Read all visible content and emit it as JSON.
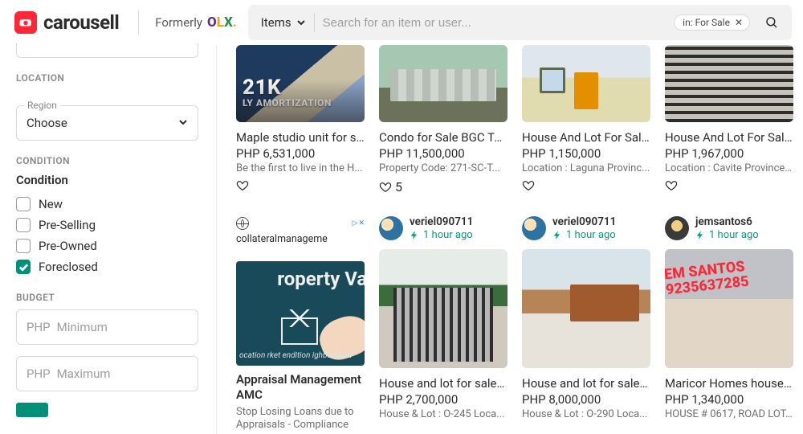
{
  "header": {
    "brand_name": "carousell",
    "formerly_label": "Formerly",
    "search_scope": "Items",
    "search_placeholder": "Search for an item or user...",
    "filter_pill": "in: For Sale"
  },
  "sidebar": {
    "location": {
      "title": "LOCATION",
      "field_label": "Region",
      "value": "Choose"
    },
    "condition": {
      "title": "CONDITION",
      "sub_label": "Condition",
      "opts": [
        {
          "label": "New",
          "checked": false
        },
        {
          "label": "Pre-Selling",
          "checked": false
        },
        {
          "label": "Pre-Owned",
          "checked": false
        },
        {
          "label": "Foreclosed",
          "checked": true
        }
      ]
    },
    "budget": {
      "title": "BUDGET",
      "currency": "PHP",
      "min_placeholder": "Minimum",
      "max_placeholder": "Maximum"
    }
  },
  "listings_row1": [
    {
      "title": "Maple studio unit for sal...",
      "price": "PHP 6,531,000",
      "sub": "Be the first to live in the H...",
      "likes": ""
    },
    {
      "title": "Condo for Sale  BGC Tag...",
      "price": "PHP 11,500,000",
      "sub": "Property Code:  271-SC-T...",
      "likes": "5"
    },
    {
      "title": "House And Lot For Sale I...",
      "price": "PHP 1,150,000",
      "sub": "Location : Laguna Provinc...",
      "likes": ""
    },
    {
      "title": "House And Lot For Sale I...",
      "price": "PHP 1,967,000",
      "sub": "Location : Cavite Province ...",
      "likes": ""
    }
  ],
  "ad": {
    "link_text": "collateralmanageme",
    "media_text": "roperty Value",
    "words": "ocation\nrket\nendition\nighborhood",
    "badge": "21K",
    "title": "Appraisal Management AMC",
    "desc": "Stop Losing Loans due to Appraisals - Compliance"
  },
  "listings_row2": [
    {
      "seller": "veriel090711",
      "time": "1 hour ago",
      "title": "House and lot for sale in ...",
      "price": "PHP 2,700,000",
      "sub": "House & Lot : O-245 Loca..."
    },
    {
      "seller": "veriel090711",
      "time": "1 hour ago",
      "title": "House and lot for sale in ...",
      "price": "PHP 8,000,000",
      "sub": "House & Lot : O-290 Loca..."
    },
    {
      "seller": "jemsantos6",
      "time": "1 hour ago",
      "title": "Maricor Homes house an...",
      "price": "PHP 1,340,000",
      "sub": "HOUSE # 0617, ROAD LOT...",
      "overlay1": "EM SANTOS",
      "overlay2": "9235637285"
    }
  ]
}
